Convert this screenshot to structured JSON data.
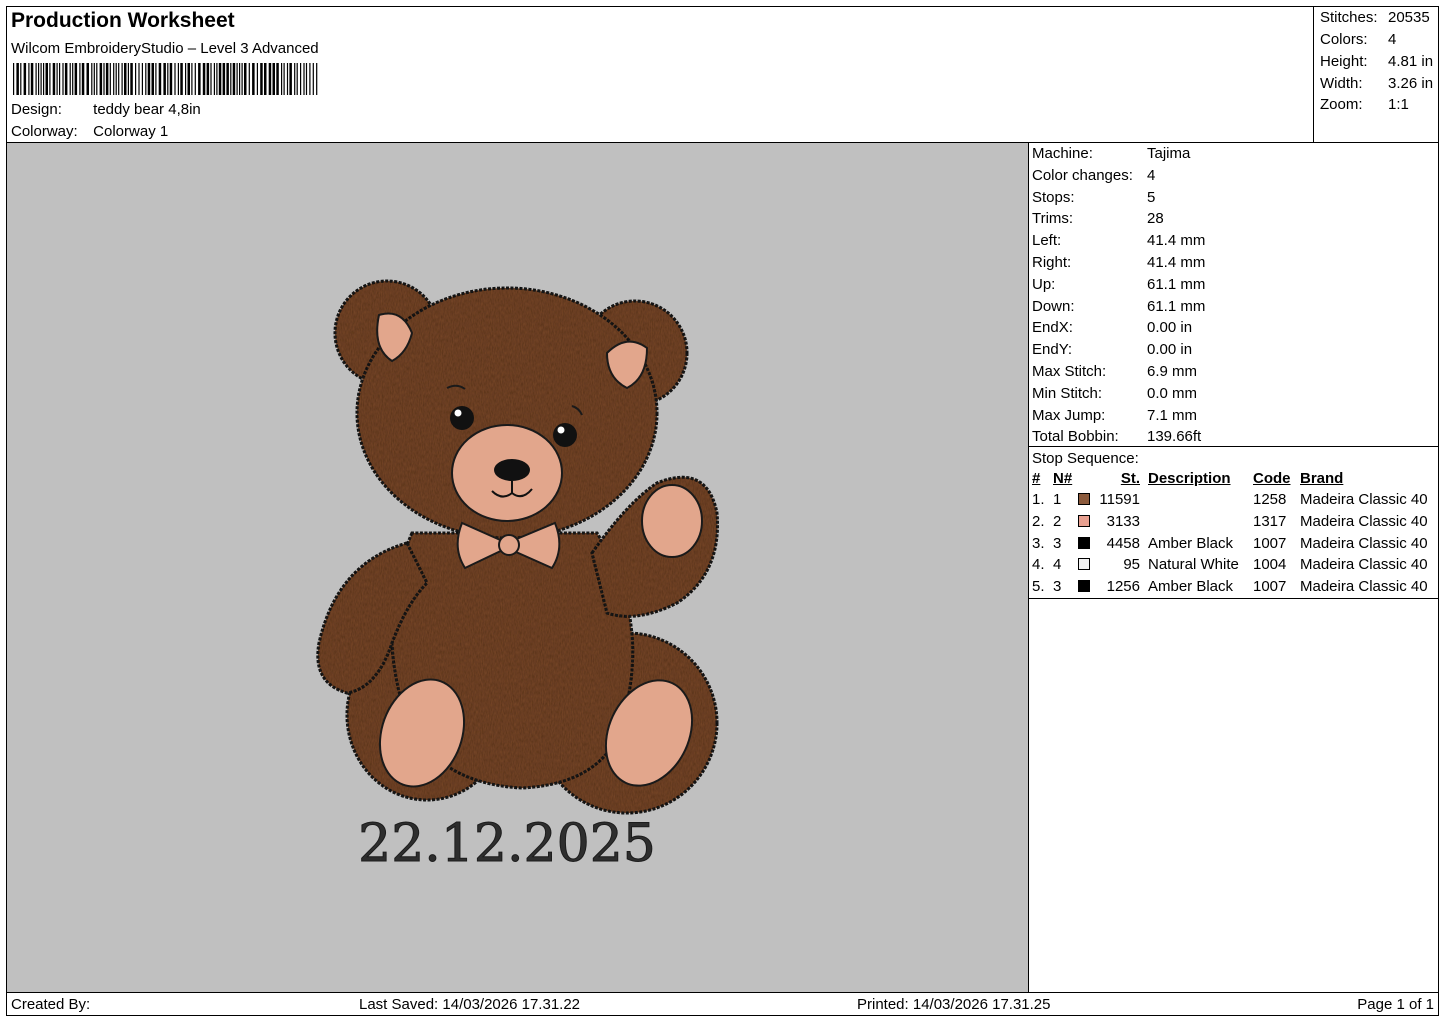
{
  "header": {
    "title": "Production Worksheet",
    "software": "Wilcom EmbroideryStudio – Level 3 Advanced",
    "design_label": "Design:",
    "design_value": "teddy bear 4,8in",
    "colorway_label": "Colorway:",
    "colorway_value": "Colorway 1"
  },
  "stats": [
    {
      "label": "Stitches:",
      "value": "20535"
    },
    {
      "label": "Colors:",
      "value": "4"
    },
    {
      "label": "Height:",
      "value": "4.81 in"
    },
    {
      "label": "Width:",
      "value": "3.26 in"
    },
    {
      "label": "Zoom:",
      "value": "1:1"
    }
  ],
  "machine_info": [
    {
      "label": "Machine:",
      "value": "Tajima"
    },
    {
      "label": "Color changes:",
      "value": "4"
    },
    {
      "label": "Stops:",
      "value": "5"
    },
    {
      "label": "Trims:",
      "value": "28"
    },
    {
      "label": "Left:",
      "value": "41.4 mm"
    },
    {
      "label": "Right:",
      "value": "41.4 mm"
    },
    {
      "label": "Up:",
      "value": "61.1 mm"
    },
    {
      "label": "Down:",
      "value": "61.1 mm"
    },
    {
      "label": "EndX:",
      "value": "0.00 in"
    },
    {
      "label": "EndY:",
      "value": "0.00 in"
    },
    {
      "label": "Max Stitch:",
      "value": "6.9 mm"
    },
    {
      "label": "Min Stitch:",
      "value": "0.0 mm"
    },
    {
      "label": "Max Jump:",
      "value": "7.1 mm"
    },
    {
      "label": "Total Bobbin:",
      "value": "139.66ft"
    }
  ],
  "stop_sequence": {
    "title": "Stop Sequence:",
    "headers": {
      "num": "#",
      "n": "N#",
      "st": "St.",
      "description": "Description",
      "code": "Code",
      "brand": "Brand"
    },
    "rows": [
      {
        "num": "1.",
        "n": "1",
        "color": "#8b5a3c",
        "st": "11591",
        "description": "",
        "code": "1258",
        "brand": "Madeira Classic 40"
      },
      {
        "num": "2.",
        "n": "2",
        "color": "#e8a090",
        "st": "3133",
        "description": "",
        "code": "1317",
        "brand": "Madeira Classic 40"
      },
      {
        "num": "3.",
        "n": "3",
        "color": "#000000",
        "st": "4458",
        "description": "Amber Black",
        "code": "1007",
        "brand": "Madeira Classic 40"
      },
      {
        "num": "4.",
        "n": "4",
        "color": "#f2f2f2",
        "st": "95",
        "description": "Natural White",
        "code": "1004",
        "brand": "Madeira Classic 40"
      },
      {
        "num": "5.",
        "n": "3",
        "color": "#000000",
        "st": "1256",
        "description": "Amber Black",
        "code": "1007",
        "brand": "Madeira Classic 40"
      }
    ]
  },
  "preview": {
    "date_text": "22.12.2025",
    "background": "#c0c0c0",
    "fur_color": "#7a4a2c",
    "pad_color": "#e2a68c"
  },
  "footer": {
    "created_by": "Created By:",
    "last_saved": "Last Saved: 14/03/2026 17.31.22",
    "printed": "Printed: 14/03/2026 17.31.25",
    "page": "Page 1 of 1"
  }
}
